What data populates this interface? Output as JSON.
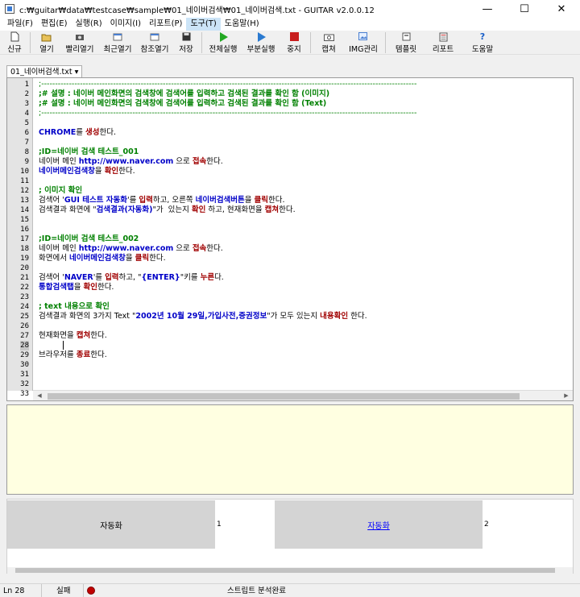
{
  "window": {
    "title": "c:₩guitar₩data₩testcase₩sample₩01_네이버검색₩01_네이버검색.txt - GUITAR v2.0.0.12",
    "minimize": "—",
    "maximize": "☐",
    "close": "✕"
  },
  "menu": [
    {
      "label": "파일(F)"
    },
    {
      "label": "편집(E)"
    },
    {
      "label": "실행(R)"
    },
    {
      "label": "이미지(I)"
    },
    {
      "label": "리포트(P)"
    },
    {
      "label": "도구(T)"
    },
    {
      "label": "도움말(H)"
    }
  ],
  "toolbar": [
    {
      "label": "신규",
      "icon": "new-file-icon"
    },
    {
      "label": "열기",
      "icon": "open-folder-icon"
    },
    {
      "label": "빨리열기",
      "icon": "quick-open-icon"
    },
    {
      "label": "최근열기",
      "icon": "recent-open-icon"
    },
    {
      "label": "참조열기",
      "icon": "reference-open-icon"
    },
    {
      "label": "저장",
      "icon": "save-icon"
    },
    {
      "label": "전체실행",
      "icon": "play-icon"
    },
    {
      "label": "부분실행",
      "icon": "partial-run-icon"
    },
    {
      "label": "중지",
      "icon": "stop-icon"
    },
    {
      "label": "캡쳐",
      "icon": "camera-icon"
    },
    {
      "label": "IMG관리",
      "icon": "image-manager-icon"
    },
    {
      "label": "템플릿",
      "icon": "template-icon"
    },
    {
      "label": "리포트",
      "icon": "report-icon"
    },
    {
      "label": "도움말",
      "icon": "help-icon"
    }
  ],
  "tab": {
    "label": "01_네이버검색.txt",
    "dropdown": "▾"
  },
  "editor": {
    "current_line": 28,
    "lines": [
      [
        [
          "dash",
          ";----------------------------------------------------------------------------------------------------------------------------------------"
        ]
      ],
      [
        [
          "green",
          ";# 설명 : 네이버 메인화면의 검색창에 검색어를 입력하고 검색된 결과를 확인 함 (이미지)"
        ]
      ],
      [
        [
          "green",
          ";# 설명 : 네이버 메인화면의 검색창에 검색어를 입력하고 검색된 결과를 확인 함 (Text)"
        ]
      ],
      [
        [
          "dash",
          ";----------------------------------------------------------------------------------------------------------------------------------------"
        ]
      ],
      [],
      [
        [
          "kw",
          "CHROME"
        ],
        [
          "txt",
          "를 "
        ],
        [
          "act",
          "생성"
        ],
        [
          "txt",
          "한다."
        ]
      ],
      [],
      [
        [
          "green",
          ";ID=네이버 검색 테스트_001"
        ]
      ],
      [
        [
          "txt",
          "네이버 메인 "
        ],
        [
          "str",
          "http://www.naver.com"
        ],
        [
          "txt",
          " 으로 "
        ],
        [
          "act",
          "접속"
        ],
        [
          "txt",
          "한다."
        ]
      ],
      [
        [
          "kw",
          "네이버메인검색창"
        ],
        [
          "txt",
          "을 "
        ],
        [
          "act",
          "확인"
        ],
        [
          "txt",
          "한다."
        ]
      ],
      [],
      [
        [
          "green",
          "; 이미지 확인"
        ]
      ],
      [
        [
          "txt",
          "검색어 '"
        ],
        [
          "str",
          "GUI 테스트 자동화"
        ],
        [
          "txt",
          "'를 "
        ],
        [
          "act",
          "입력"
        ],
        [
          "txt",
          "하고, 오른쪽 "
        ],
        [
          "kw",
          "네이버검색버튼"
        ],
        [
          "txt",
          "을 "
        ],
        [
          "act",
          "클릭"
        ],
        [
          "txt",
          "한다."
        ]
      ],
      [
        [
          "txt",
          "검색결과 화면에 \""
        ],
        [
          "str",
          "검색결과(자동화)"
        ],
        [
          "txt",
          "\"가  있는지 "
        ],
        [
          "act",
          "확인"
        ],
        [
          "txt",
          " 하고, 현재화면을 "
        ],
        [
          "act",
          "캡쳐"
        ],
        [
          "txt",
          "한다."
        ]
      ],
      [],
      [],
      [
        [
          "green",
          ";ID=네이버 검색 테스트_002"
        ]
      ],
      [
        [
          "txt",
          "네이버 메인 "
        ],
        [
          "str",
          "http://www.naver.com"
        ],
        [
          "txt",
          " 으로 "
        ],
        [
          "act",
          "접속"
        ],
        [
          "txt",
          "한다."
        ]
      ],
      [
        [
          "txt",
          "화면에서 "
        ],
        [
          "kw",
          "네이버메인검색창"
        ],
        [
          "txt",
          "을 "
        ],
        [
          "act",
          "클릭"
        ],
        [
          "txt",
          "한다."
        ]
      ],
      [],
      [
        [
          "txt",
          "검색어 '"
        ],
        [
          "str",
          "NAVER"
        ],
        [
          "txt",
          "'를 "
        ],
        [
          "act",
          "입력"
        ],
        [
          "txt",
          "하고, \""
        ],
        [
          "str",
          "{ENTER}"
        ],
        [
          "txt",
          "\"키를 "
        ],
        [
          "act",
          "누른"
        ],
        [
          "txt",
          "다."
        ]
      ],
      [
        [
          "kw",
          "통합검색탭"
        ],
        [
          "txt",
          "을 "
        ],
        [
          "act",
          "확인"
        ],
        [
          "txt",
          "한다."
        ]
      ],
      [],
      [
        [
          "green",
          "; text 내용으로 확인"
        ]
      ],
      [
        [
          "txt",
          "검색결과 화면의 3가지 Text \""
        ],
        [
          "str",
          "2002년 10월 29일,가입사전,증권정보"
        ],
        [
          "txt",
          "\"가 모두 있는지 "
        ],
        [
          "act",
          "내용확인"
        ],
        [
          "txt",
          " 한다."
        ]
      ],
      [],
      [
        [
          "txt",
          "현재화면을 "
        ],
        [
          "act",
          "캡쳐"
        ],
        [
          "txt",
          "한다."
        ]
      ],
      [],
      [
        [
          "txt",
          "브라우저를 "
        ],
        [
          "act",
          "종료"
        ],
        [
          "txt",
          "한다."
        ]
      ],
      [],
      [],
      [],
      []
    ]
  },
  "results": [
    {
      "label": "자동화",
      "number": "1",
      "link": false
    },
    {
      "label": "자동화",
      "number": "2",
      "link": true
    }
  ],
  "status": {
    "line": "Ln 28",
    "result": "실패",
    "indicator_color": "#c00000",
    "message": "스트립트 분석완료"
  }
}
